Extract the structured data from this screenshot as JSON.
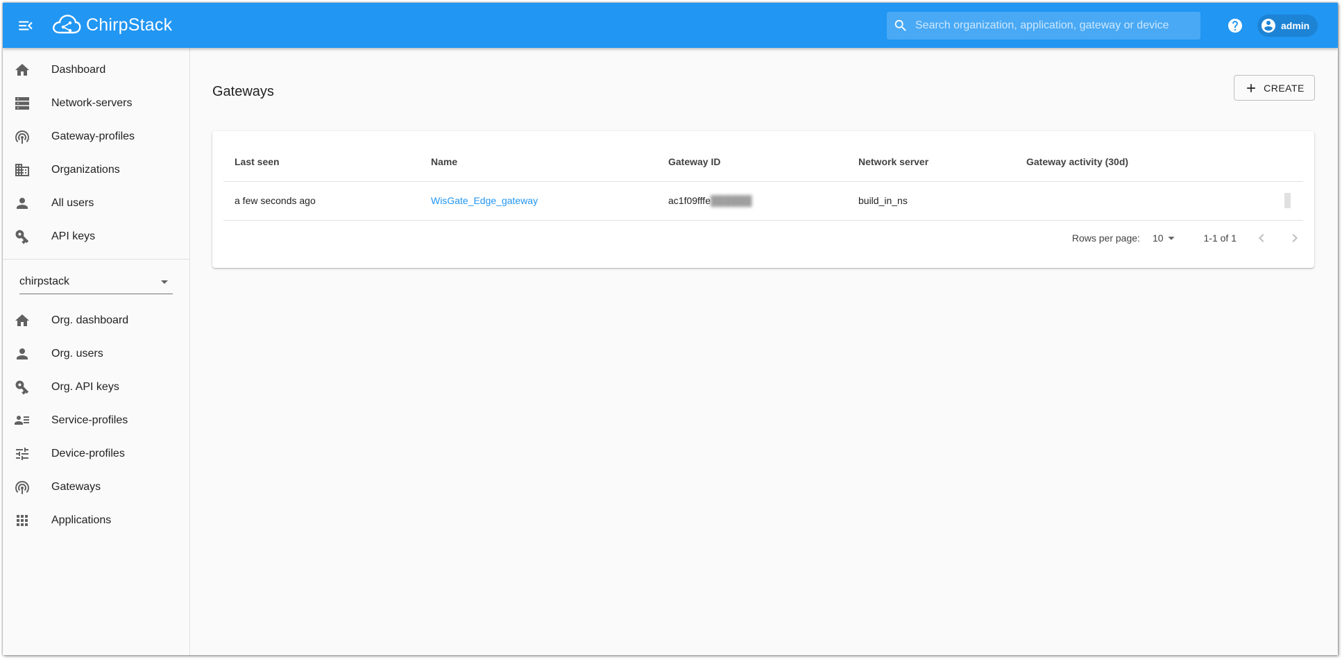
{
  "app": {
    "title": "ChirpStack",
    "brand_color": "#2196f3"
  },
  "header": {
    "search_placeholder": "Search organization, application, gateway or device",
    "user_label": "admin"
  },
  "sidebar": {
    "admin_items": [
      {
        "label": "Dashboard",
        "icon": "home-icon"
      },
      {
        "label": "Network-servers",
        "icon": "server-icon"
      },
      {
        "label": "Gateway-profiles",
        "icon": "router-icon"
      },
      {
        "label": "Organizations",
        "icon": "building-icon"
      },
      {
        "label": "All users",
        "icon": "person-icon"
      },
      {
        "label": "API keys",
        "icon": "key-icon"
      }
    ],
    "org_selector": "chirpstack",
    "org_items": [
      {
        "label": "Org. dashboard",
        "icon": "home-icon"
      },
      {
        "label": "Org. users",
        "icon": "person-icon"
      },
      {
        "label": "Org. API keys",
        "icon": "key-icon"
      },
      {
        "label": "Service-profiles",
        "icon": "account-details-icon"
      },
      {
        "label": "Device-profiles",
        "icon": "tune-icon"
      },
      {
        "label": "Gateways",
        "icon": "router-icon"
      },
      {
        "label": "Applications",
        "icon": "apps-icon"
      }
    ]
  },
  "main": {
    "title": "Gateways",
    "create_label": "CREATE",
    "table": {
      "columns": [
        "Last seen",
        "Name",
        "Gateway ID",
        "Network server",
        "Gateway activity (30d)"
      ],
      "rows": [
        {
          "last_seen": "a few seconds ago",
          "name": "WisGate_Edge_gateway",
          "gateway_id_visible": "ac1f09fffe",
          "network_server": "build_in_ns"
        }
      ]
    },
    "pagination": {
      "rows_per_page_label": "Rows per page:",
      "rows_per_page": "10",
      "range": "1-1 of 1"
    }
  }
}
